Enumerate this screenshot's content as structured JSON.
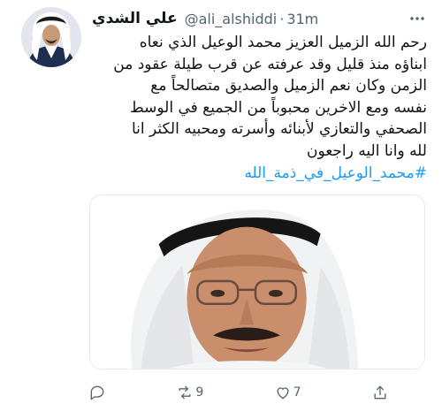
{
  "tweet": {
    "display_name": "علي الشدي",
    "handle": "@ali_alshiddi",
    "separator": "·",
    "time": "31m",
    "body_lines": [
      "رحم الله الزميل العزيز محمد الوعيل الذي نعاه",
      "ابناؤه منذ قليل وقد عرفته عن قرب طيلة عقود من",
      "الزمن وكان نعم الزميل والصديق متصالحاً مع",
      "نفسه ومع الاخرين محبوباً من الجميع في الوسط",
      "الصحفي والتعازي لأبنائه وأسرته ومحبيه الكثر انا",
      "لله وانا اليه راجعون"
    ],
    "hashtag": "#محمد_الوعيل_في_ذمة_الله",
    "link_color": "#1d9bf0"
  },
  "actions": {
    "reply_icon": "reply-icon",
    "retweet_icon": "retweet-icon",
    "retweet_count": "9",
    "like_icon": "heart-icon",
    "like_count": "7",
    "share_icon": "share-icon"
  }
}
